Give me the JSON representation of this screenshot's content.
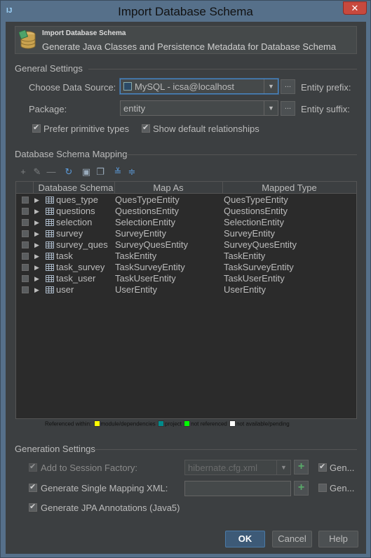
{
  "window": {
    "title": "Import Database Schema",
    "app_icon": "IJ",
    "close_label": "✕"
  },
  "banner": {
    "title": "Import Database Schema",
    "description": "Generate Java Classes and Persistence Metadata for Database Schema",
    "icon": "database-icon"
  },
  "general": {
    "section_label": "General Settings",
    "data_source_label": "Choose Data Source:",
    "data_source_value": "MySQL - icsa@localhost",
    "package_label": "Package:",
    "package_value": "entity",
    "entity_prefix_label": "Entity prefix:",
    "entity_suffix_label": "Entity suffix:",
    "more_label": "...",
    "prefer_primitive_label": "Prefer primitive types",
    "prefer_primitive_checked": true,
    "show_default_rel_label": "Show default relationships",
    "show_default_rel_checked": true
  },
  "mapping": {
    "section_label": "Database Schema Mapping",
    "toolbar_icons": [
      "add-icon",
      "edit-icon",
      "remove-icon",
      "refresh-icon",
      "select-all-icon",
      "unselect-all-icon",
      "expand-all-icon",
      "collapse-all-icon"
    ],
    "columns": [
      "Database Schema",
      "Map As",
      "Mapped Type"
    ],
    "rows": [
      {
        "schema": "ques_type",
        "map_as": "QuesTypeEntity",
        "mapped_type": "QuesTypeEntity"
      },
      {
        "schema": "questions",
        "map_as": "QuestionsEntity",
        "mapped_type": "QuestionsEntity"
      },
      {
        "schema": "selection",
        "map_as": "SelectionEntity",
        "mapped_type": "SelectionEntity"
      },
      {
        "schema": "survey",
        "map_as": "SurveyEntity",
        "mapped_type": "SurveyEntity"
      },
      {
        "schema": "survey_ques",
        "map_as": "SurveyQuesEntity",
        "mapped_type": "SurveyQuesEntity"
      },
      {
        "schema": "task",
        "map_as": "TaskEntity",
        "mapped_type": "TaskEntity"
      },
      {
        "schema": "task_survey",
        "map_as": "TaskSurveyEntity",
        "mapped_type": "TaskSurveyEntity"
      },
      {
        "schema": "task_user",
        "map_as": "TaskUserEntity",
        "mapped_type": "TaskUserEntity"
      },
      {
        "schema": "user",
        "map_as": "UserEntity",
        "mapped_type": "UserEntity"
      }
    ]
  },
  "legend": {
    "prefix": "Referenced within:",
    "items": [
      {
        "label": "module/dependencies",
        "color": "#ffff00"
      },
      {
        "label": "project",
        "color": "#008b8b"
      },
      {
        "label": "not referenced",
        "color": "#00ff00"
      },
      {
        "label": "not available/pending",
        "color": "#ffffff"
      }
    ]
  },
  "generation": {
    "section_label": "Generation Settings",
    "add_session_label": "Add to Session Factory:",
    "add_session_checked": true,
    "session_combo_value": "hibernate.cfg.xml",
    "gen1_label": "Gen...",
    "gen1_checked": true,
    "single_mapping_label": "Generate Single Mapping XML:",
    "single_mapping_checked": true,
    "single_mapping_value": "",
    "gen2_label": "Gen...",
    "gen2_checked": false,
    "jpa_label": "Generate JPA Annotations (Java5)",
    "jpa_checked": true,
    "plus_label": "+"
  },
  "buttons": {
    "ok": "OK",
    "cancel": "Cancel",
    "help": "Help"
  }
}
